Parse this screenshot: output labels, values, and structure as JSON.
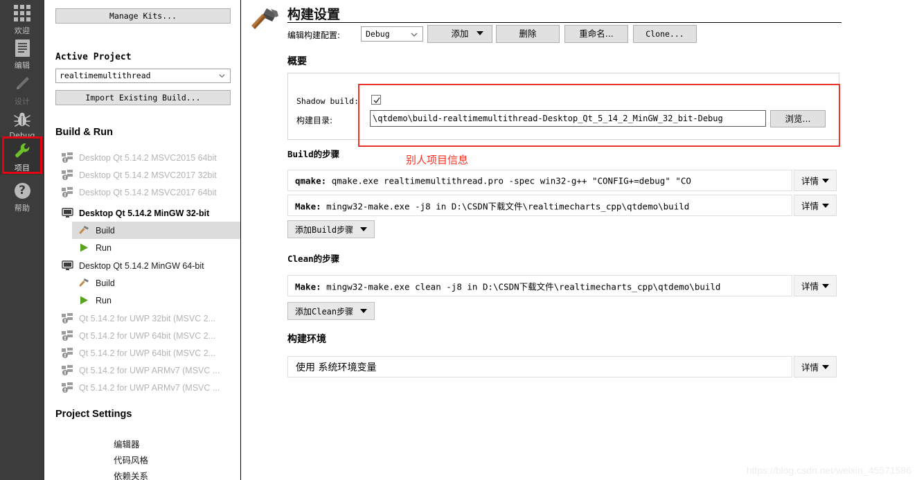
{
  "modebar": {
    "items": [
      {
        "label": "欢迎",
        "icon": "grid-icon",
        "state": "normal"
      },
      {
        "label": "编辑",
        "icon": "document-icon",
        "state": "normal"
      },
      {
        "label": "设计",
        "icon": "pencil-icon",
        "state": "disabled"
      },
      {
        "label": "Debug",
        "icon": "bug-icon",
        "state": "normal"
      },
      {
        "label": "项目",
        "icon": "wrench-icon",
        "state": "active"
      },
      {
        "label": "帮助",
        "icon": "question-circle-icon",
        "state": "normal"
      }
    ],
    "selection_highlight_color": "#e60012"
  },
  "tree": {
    "manage_kits_label": "Manage Kits...",
    "active_project_heading": "Active Project",
    "active_project_value": "realtimemultithread",
    "import_existing_label": "Import Existing Build...",
    "build_run_heading": "Build & Run",
    "kits": [
      {
        "label": "Desktop Qt 5.14.2 MSVC2015 64bit",
        "icon": "kit-warning-icon",
        "enabled": false,
        "bold": false,
        "indent": 24
      },
      {
        "label": "Desktop Qt 5.14.2 MSVC2017 32bit",
        "icon": "kit-warning-icon",
        "enabled": false,
        "bold": false,
        "indent": 24
      },
      {
        "label": "Desktop Qt 5.14.2 MSVC2017 64bit",
        "icon": "kit-warning-icon",
        "enabled": false,
        "bold": false,
        "indent": 24
      },
      {
        "label": "Desktop Qt 5.14.2 MinGW 32-bit",
        "icon": "desktop-icon",
        "enabled": true,
        "bold": true,
        "indent": 24
      },
      {
        "label": "Build",
        "icon": "hammer-icon",
        "enabled": true,
        "bold": false,
        "indent": 48,
        "selected": true
      },
      {
        "label": "Run",
        "icon": "play-icon",
        "enabled": true,
        "bold": false,
        "indent": 48
      },
      {
        "label": "Desktop Qt 5.14.2 MinGW 64-bit",
        "icon": "desktop-icon",
        "enabled": true,
        "bold": false,
        "indent": 24
      },
      {
        "label": "Build",
        "icon": "hammer-icon",
        "enabled": true,
        "bold": false,
        "indent": 48
      },
      {
        "label": "Run",
        "icon": "play-icon",
        "enabled": true,
        "bold": false,
        "indent": 48
      },
      {
        "label": "Qt 5.14.2 for UWP 32bit (MSVC 2...",
        "icon": "kit-warning-icon",
        "enabled": false,
        "bold": false,
        "indent": 24
      },
      {
        "label": "Qt 5.14.2 for UWP 64bit (MSVC 2...",
        "icon": "kit-warning-icon",
        "enabled": false,
        "bold": false,
        "indent": 24
      },
      {
        "label": "Qt 5.14.2 for UWP 64bit (MSVC 2...",
        "icon": "kit-warning-icon",
        "enabled": false,
        "bold": false,
        "indent": 24
      },
      {
        "label": "Qt 5.14.2 for UWP ARMv7 (MSVC ...",
        "icon": "kit-warning-icon",
        "enabled": false,
        "bold": false,
        "indent": 24
      },
      {
        "label": "Qt 5.14.2 for UWP ARMv7 (MSVC ...",
        "icon": "kit-warning-icon",
        "enabled": false,
        "bold": false,
        "indent": 24
      }
    ],
    "project_settings_heading": "Project Settings",
    "project_settings_items": [
      "编辑器",
      "代码风格",
      "依赖关系"
    ]
  },
  "main": {
    "title": "构建设置",
    "config_label": "编辑构建配置:",
    "config_value": "Debug",
    "buttons": {
      "add": "添加",
      "remove": "删除",
      "rename": "重命名...",
      "clone": "Clone..."
    },
    "summary_heading": "概要",
    "shadow_build_label": "Shadow build:",
    "shadow_build_checked": true,
    "build_dir_label": "构建目录:",
    "build_dir_value": "\\qtdemo\\build-realtimemultithread-Desktop_Qt_5_14_2_MinGW_32_bit-Debug",
    "browse_label": "浏览...",
    "annotation": "别人项目信息",
    "annotation_color": "#ff2d20",
    "build_steps_heading": "Build的步骤",
    "build_steps": [
      {
        "name": "qmake:",
        "command": "qmake.exe realtimemultithread.pro -spec win32-g++ \"CONFIG+=debug\" \"CO"
      },
      {
        "name": "Make:",
        "command": "mingw32-make.exe -j8 in D:\\CSDN下载文件\\realtimecharts_cpp\\qtdemo\\build"
      }
    ],
    "add_build_step_label": "添加Build步骤",
    "clean_steps_heading": "Clean的步骤",
    "clean_steps": [
      {
        "name": "Make:",
        "command": "mingw32-make.exe clean -j8 in D:\\CSDN下载文件\\realtimecharts_cpp\\qtdemo\\build"
      }
    ],
    "add_clean_step_label": "添加Clean步骤",
    "build_env_heading": "构建环境",
    "build_env_value": "使用 系统环境变量",
    "details_label": "详情"
  },
  "watermark": "https://blog.csdn.net/weixin_45571586"
}
